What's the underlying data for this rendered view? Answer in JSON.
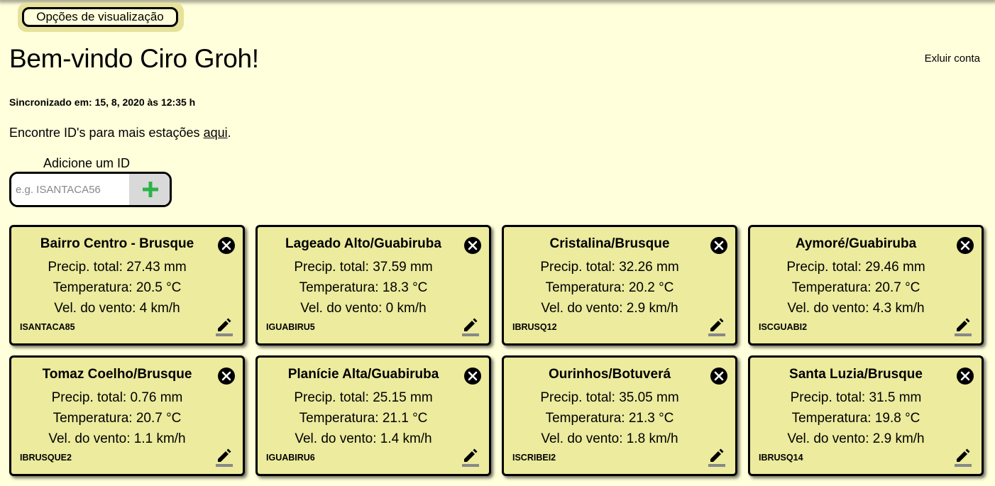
{
  "view_options": {
    "label": "Opções de visualização"
  },
  "header": {
    "welcome": "Bem-vindo Ciro Groh!",
    "delete_account": "Exluir conta"
  },
  "sync": {
    "text": "Sincronizado em: 15, 8, 2020 às 12:35 h"
  },
  "find_ids": {
    "prefix": "Encontre ID's para mais estações ",
    "link": "aqui",
    "suffix": "."
  },
  "add_station": {
    "label": "Adicione um ID",
    "placeholder": "e.g. ISANTACA56",
    "button_icon": "plus-icon",
    "accent": "#2bb34a"
  },
  "colors": {
    "background": "#ffffdc",
    "card": "#eceb9e",
    "border": "#000000"
  },
  "stations": [
    {
      "name": "Bairro Centro - Brusque",
      "precip": "Precip. total: 27.43 mm",
      "temp": "Temperatura: 20.5 °C",
      "wind": "Vel. do vento: 4 km/h",
      "id": "ISANTACA85"
    },
    {
      "name": "Lageado Alto/Guabiruba",
      "precip": "Precip. total: 37.59 mm",
      "temp": "Temperatura: 18.3 °C",
      "wind": "Vel. do vento: 0 km/h",
      "id": "IGUABIRU5"
    },
    {
      "name": "Cristalina/Brusque",
      "precip": "Precip. total: 32.26 mm",
      "temp": "Temperatura: 20.2 °C",
      "wind": "Vel. do vento: 2.9 km/h",
      "id": "IBRUSQ12"
    },
    {
      "name": "Aymoré/Guabiruba",
      "precip": "Precip. total: 29.46 mm",
      "temp": "Temperatura: 20.7 °C",
      "wind": "Vel. do vento: 4.3 km/h",
      "id": "ISCGUABI2"
    },
    {
      "name": "Tomaz Coelho/Brusque",
      "precip": "Precip. total: 0.76 mm",
      "temp": "Temperatura: 20.7 °C",
      "wind": "Vel. do vento: 1.1 km/h",
      "id": "IBRUSQUE2"
    },
    {
      "name": "Planície Alta/Guabiruba",
      "precip": "Precip. total: 25.15 mm",
      "temp": "Temperatura: 21.1 °C",
      "wind": "Vel. do vento: 1.4 km/h",
      "id": "IGUABIRU6"
    },
    {
      "name": "Ourinhos/Botuverá",
      "precip": "Precip. total: 35.05 mm",
      "temp": "Temperatura: 21.3 °C",
      "wind": "Vel. do vento: 1.8 km/h",
      "id": "ISCRIBEI2"
    },
    {
      "name": "Santa Luzia/Brusque",
      "precip": "Precip. total: 31.5 mm",
      "temp": "Temperatura: 19.8 °C",
      "wind": "Vel. do vento: 2.9 km/h",
      "id": "IBRUSQ14"
    }
  ]
}
